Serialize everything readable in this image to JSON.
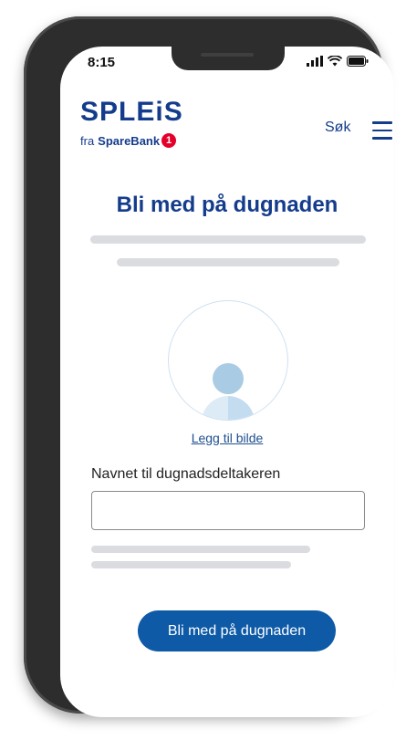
{
  "status_bar": {
    "time": "8:15",
    "icons": [
      "cellular-signal-icon",
      "wifi-icon",
      "battery-icon"
    ]
  },
  "header": {
    "logo_text": "SPLEiS",
    "logo_sub_prefix": "fra",
    "logo_sub_brand": "SpareBank",
    "logo_sub_badge": "1",
    "search_label": "Søk",
    "menu_icon": "hamburger-menu-icon"
  },
  "main": {
    "title": "Bli med på dugnaden",
    "avatar_icon": "person-placeholder-icon",
    "add_photo_label": "Legg til bilde",
    "name_field": {
      "label": "Navnet til dugnadsdeltakeren",
      "value": "",
      "placeholder": ""
    },
    "submit_label": "Bli med på dugnaden"
  },
  "colors": {
    "brand_navy": "#143c8c",
    "button_blue": "#0e5aa7",
    "sparebank_red": "#e4002b",
    "skeleton_gray": "#dadcdf",
    "device_frame": "#2d2d2d"
  }
}
